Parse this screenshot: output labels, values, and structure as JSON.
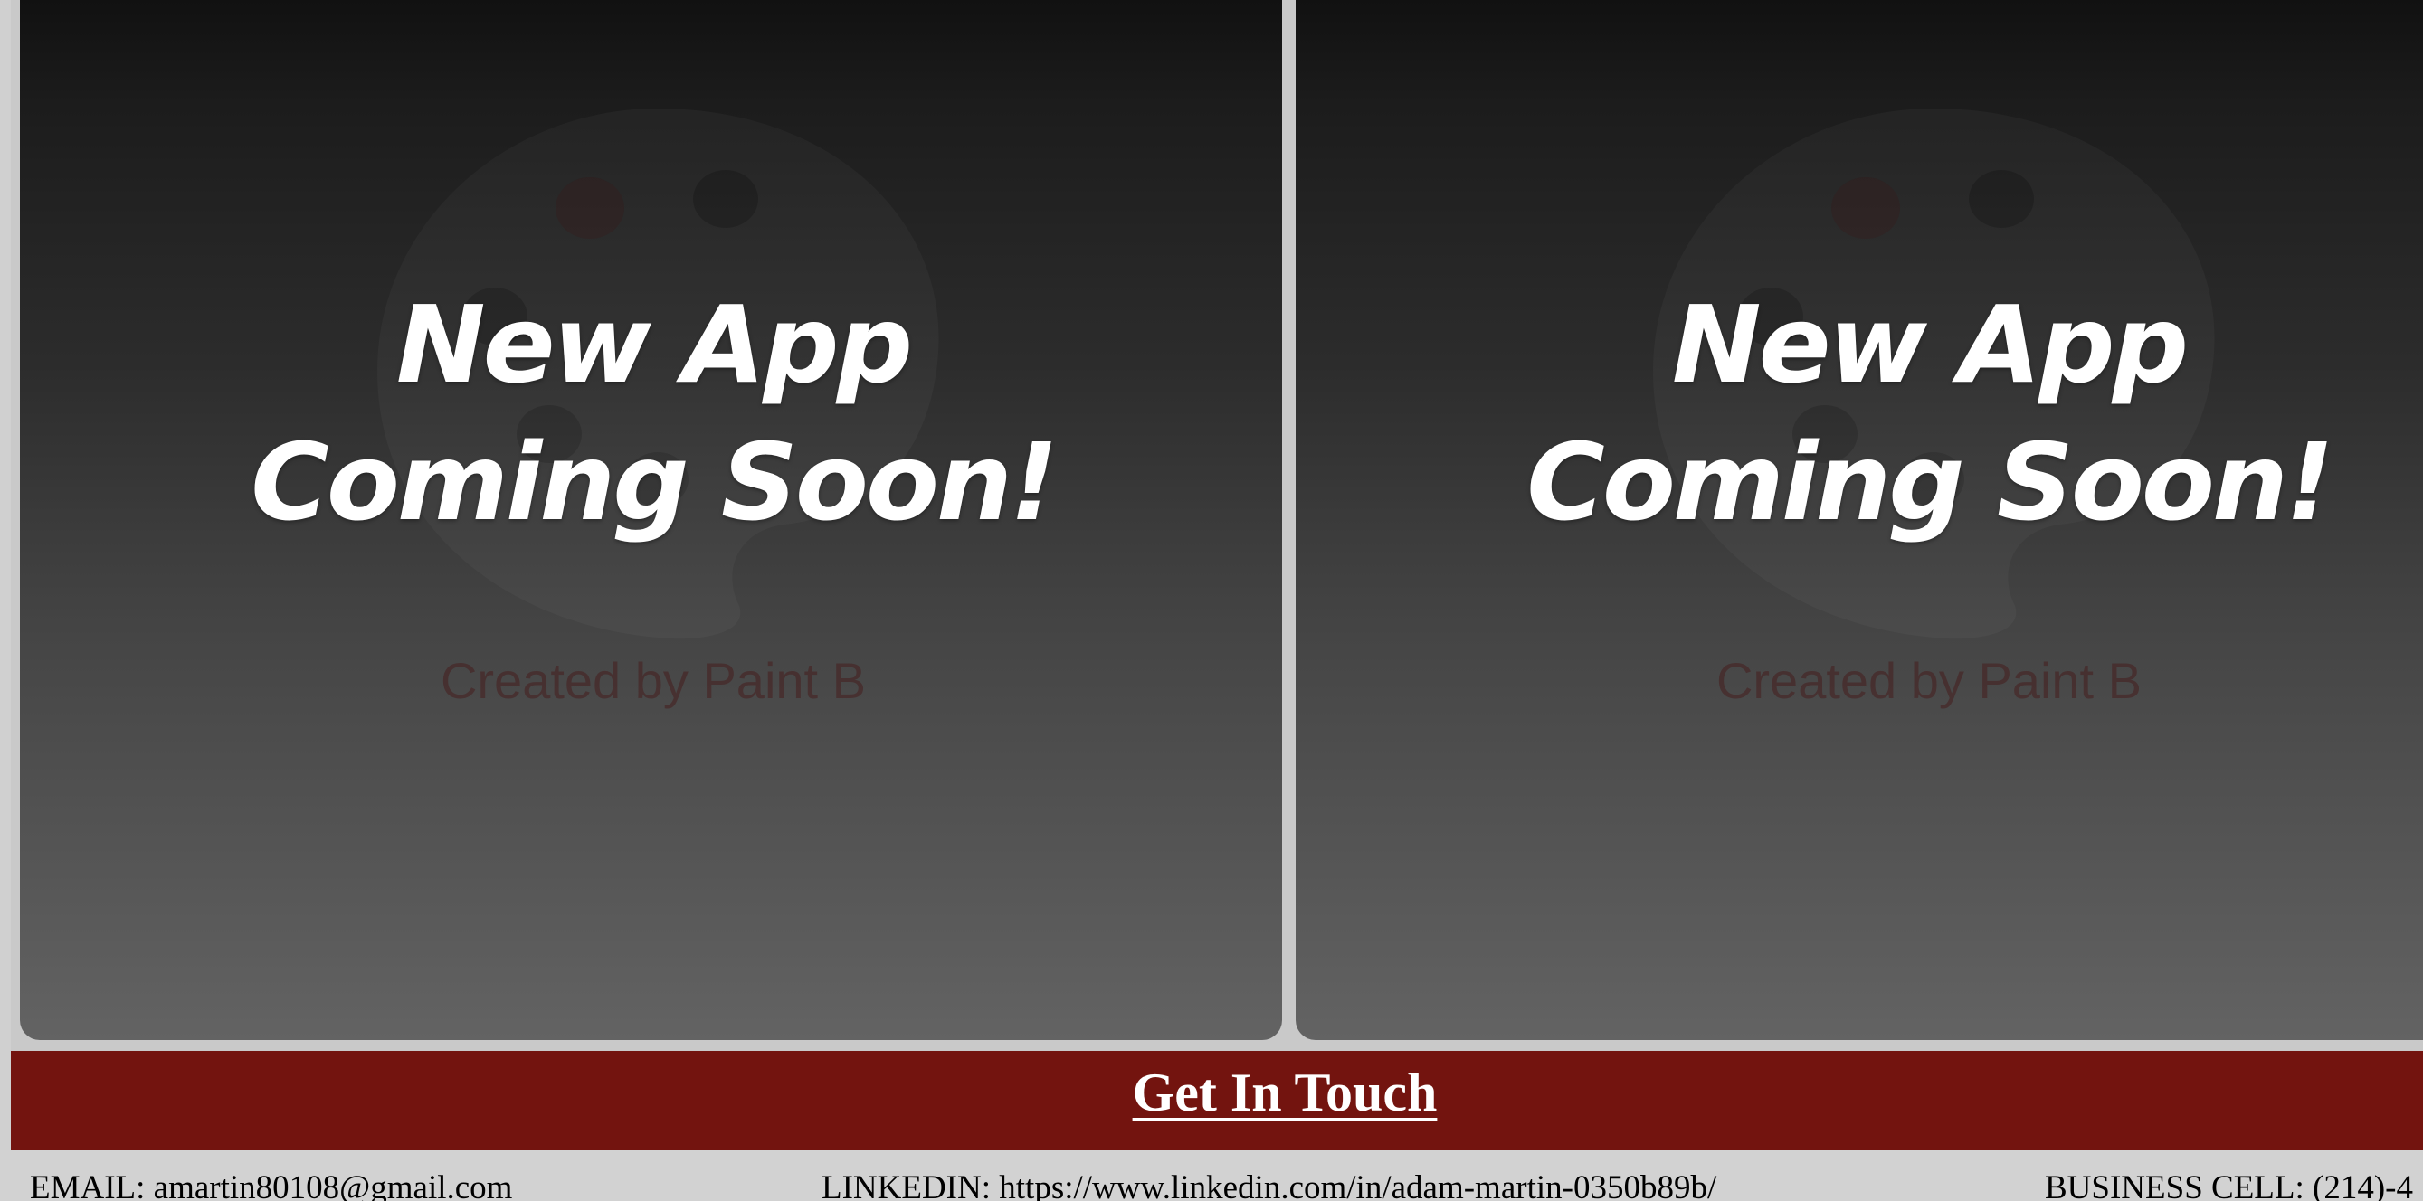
{
  "cards": [
    {
      "line1": "New App",
      "line2": "Coming Soon!",
      "credit": "Created by Paint B"
    },
    {
      "line1": "New App",
      "line2": "Coming Soon!",
      "credit": "Created by Paint B"
    }
  ],
  "get_in_touch": {
    "title": "Get In Touch"
  },
  "contact": {
    "email": "EMAIL: amartin80108@gmail.com",
    "linkedin": "LINKEDIN: https://www.linkedin.com/in/adam-martin-0350b89b/",
    "cell": "BUSINESS CELL: (214)-4"
  },
  "colors": {
    "accent_bar": "#73140f",
    "page_bg": "#d0d0d0"
  },
  "icons": {
    "card_background": "paint-palette-icon"
  }
}
